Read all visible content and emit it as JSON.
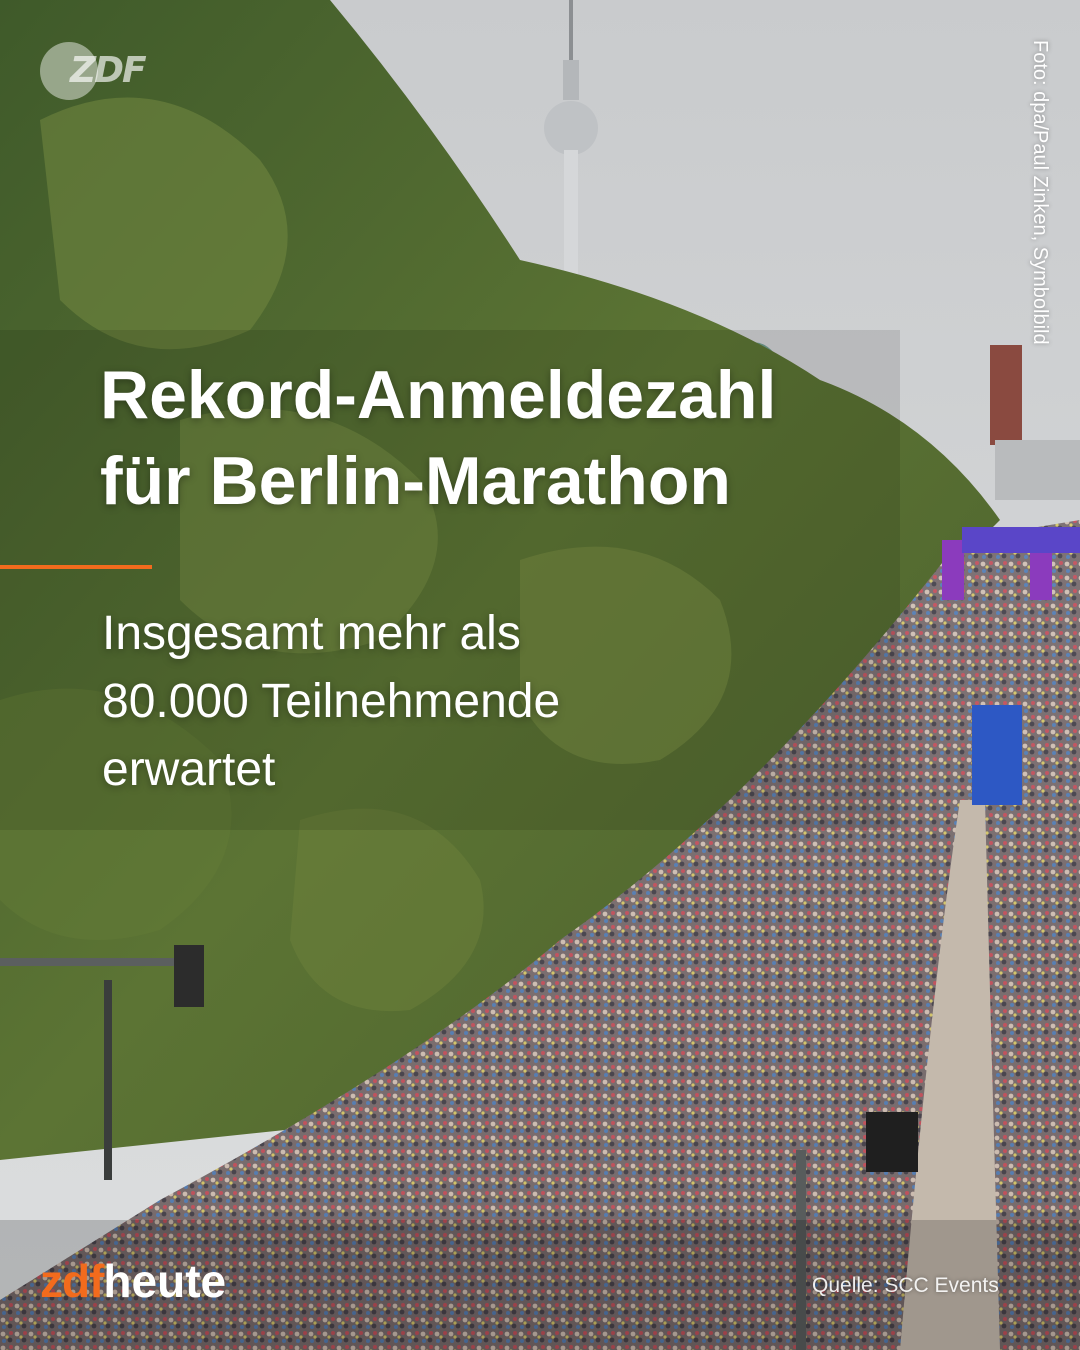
{
  "post": {
    "headline_lines": [
      "Rekord-Anmeldezahl",
      "für Berlin-Marathon"
    ],
    "subline_lines": [
      "Insgesamt mehr als",
      "80.000 Teilnehmende",
      "erwartet"
    ],
    "photo_credit": "Foto: dpa/Paul Zinken, Symbolbild",
    "source": "Quelle: SCC Events"
  },
  "branding": {
    "watermark": "ZDF",
    "logo_part1": "zdf",
    "logo_part2": "heute"
  },
  "colors": {
    "accent": "#f26b1d",
    "text": "#ffffff",
    "sky": "#cfd2d4",
    "trees": "#556b2f"
  }
}
